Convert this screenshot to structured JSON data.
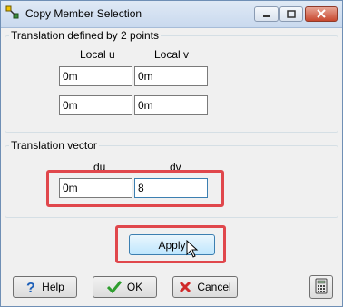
{
  "window": {
    "title": "Copy Member Selection"
  },
  "group_points": {
    "title": "Translation defined by 2 points",
    "col_u": "Local u",
    "col_v": "Local v",
    "row1": {
      "u": "0m",
      "v": "0m"
    },
    "row2": {
      "u": "0m",
      "v": "0m"
    }
  },
  "group_vector": {
    "title": "Translation vector",
    "du_label": "du",
    "dv_label": "dv",
    "du_value": "0m",
    "dv_value": "8"
  },
  "buttons": {
    "apply": "Apply",
    "help": "Help",
    "ok": "OK",
    "cancel": "Cancel"
  },
  "colors": {
    "highlight": "#e0474c",
    "ok_check": "#2f9e2f",
    "cancel_x": "#d02a2a",
    "help_q": "#1d5fb8"
  },
  "icons": [
    "app-icon",
    "minimize-icon",
    "maximize-icon",
    "close-icon",
    "help-icon",
    "check-icon",
    "cancel-x-icon",
    "calculator-icon",
    "mouse-cursor-icon"
  ]
}
